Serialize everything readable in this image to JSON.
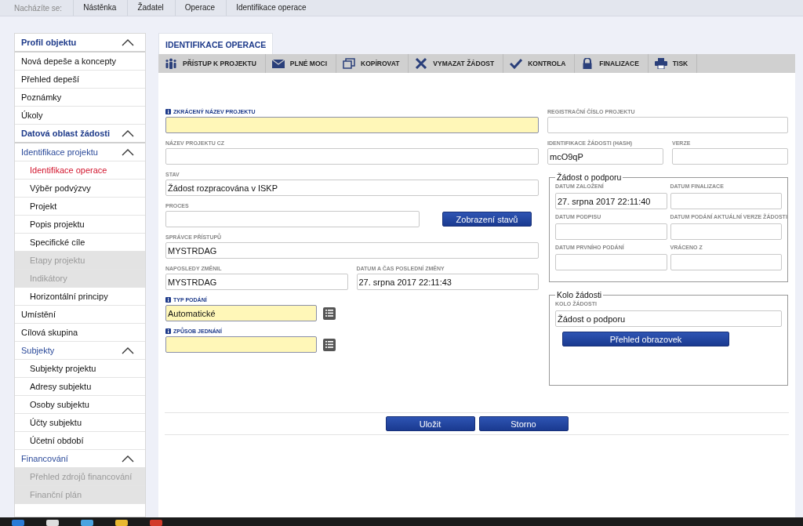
{
  "breadcrumb": {
    "prefix": "Nacházíte se:",
    "items": [
      "Nástěnka",
      "Žadatel",
      "Operace",
      "Identifikace operace"
    ]
  },
  "sidebar": [
    {
      "label": "Profil objektu",
      "kind": "section",
      "expanded": true,
      "children": [
        {
          "label": "Nová depeše a koncepty",
          "kind": "item",
          "selected": false,
          "disabled": false
        },
        {
          "label": "Přehled depeší",
          "kind": "item",
          "selected": false,
          "disabled": false
        },
        {
          "label": "Poznámky",
          "kind": "item",
          "selected": false,
          "disabled": false
        },
        {
          "label": "Úkoly",
          "kind": "item",
          "selected": false,
          "disabled": false
        }
      ]
    },
    {
      "label": "Datová oblast žádosti",
      "kind": "section",
      "expanded": true,
      "children": [
        {
          "label": "Identifikace projektu",
          "kind": "group",
          "expanded": true,
          "children": [
            {
              "label": "Identifikace operace",
              "kind": "item",
              "selected": true,
              "disabled": false
            },
            {
              "label": "Výběr podvýzvy",
              "kind": "item",
              "selected": false,
              "disabled": false
            },
            {
              "label": "Projekt",
              "kind": "item",
              "selected": false,
              "disabled": false
            },
            {
              "label": "Popis projektu",
              "kind": "item",
              "selected": false,
              "disabled": false
            },
            {
              "label": "Specifické cíle",
              "kind": "item",
              "selected": false,
              "disabled": false
            },
            {
              "label": "Etapy projektu",
              "kind": "item",
              "selected": false,
              "disabled": true
            },
            {
              "label": "Indikátory",
              "kind": "item",
              "selected": false,
              "disabled": true
            },
            {
              "label": "Horizontální principy",
              "kind": "item",
              "selected": false,
              "disabled": false
            }
          ]
        },
        {
          "label": "Umístění",
          "kind": "item",
          "selected": false,
          "disabled": false
        },
        {
          "label": "Cílová skupina",
          "kind": "item",
          "selected": false,
          "disabled": false
        },
        {
          "label": "Subjekty",
          "kind": "group",
          "expanded": true,
          "children": [
            {
              "label": "Subjekty projektu",
              "kind": "item",
              "selected": false,
              "disabled": false
            },
            {
              "label": "Adresy subjektu",
              "kind": "item",
              "selected": false,
              "disabled": false
            },
            {
              "label": "Osoby subjektu",
              "kind": "item",
              "selected": false,
              "disabled": false
            },
            {
              "label": "Účty subjektu",
              "kind": "item",
              "selected": false,
              "disabled": false
            },
            {
              "label": "Účetní období",
              "kind": "item",
              "selected": false,
              "disabled": false
            }
          ]
        },
        {
          "label": "Financování",
          "kind": "group",
          "expanded": true,
          "children": [
            {
              "label": "Přehled zdrojů financování",
              "kind": "item",
              "selected": false,
              "disabled": true
            },
            {
              "label": "Finanční plán",
              "kind": "item",
              "selected": false,
              "disabled": true
            }
          ]
        }
      ]
    }
  ],
  "tabs": [
    {
      "label": "IDENTIFIKACE OPERACE",
      "selected": true
    }
  ],
  "toolbar": [
    "PŘÍSTUP K PROJEKTU",
    "PLNÉ MOCI",
    "KOPÍROVAT",
    "VYMAZAT ŽÁDOST",
    "KONTROLA",
    "FINALIZACE",
    "TISK"
  ],
  "left_form": [
    {
      "fields": [
        {
          "kind": "field",
          "label": "ZKRÁCENÝ NÁZEV PROJEKTU",
          "required": true
        }
      ]
    },
    {
      "fields": [
        {
          "kind": "field",
          "label": "NÁZEV PROJEKTU CZ",
          "required": false
        }
      ]
    },
    {
      "fields": [
        {
          "kind": "field",
          "label": "STAV",
          "value": "Žádost rozpracována v ISKP",
          "required": false
        }
      ]
    },
    {
      "fields": [
        {
          "kind": "field",
          "label": "PROCES",
          "required": false
        },
        {
          "kind": "button",
          "label": "Zobrazení stavů"
        }
      ]
    },
    {
      "fields": [
        {
          "kind": "field",
          "label": "SPRÁVCE PŘÍSTUPŮ",
          "value": "MYSTRDAG",
          "required": false
        }
      ]
    },
    {
      "fields": [
        {
          "kind": "field",
          "label": "NAPOSLEDY ZMĚNIL",
          "value": "MYSTRDAG",
          "required": false
        },
        {
          "kind": "field",
          "label": "DATUM A ČAS POSLEDNÍ ZMĚNY",
          "value": "27. srpna 2017 22:11:43",
          "required": false
        }
      ]
    },
    {
      "fields": [
        {
          "kind": "select",
          "label": "TYP PODÁNÍ",
          "value": "Automatické",
          "required": true
        }
      ]
    },
    {
      "fields": [
        {
          "kind": "select",
          "label": "ZPŮSOB JEDNÁNÍ",
          "required": true
        }
      ]
    }
  ],
  "right_form": [
    {
      "fields": [
        {
          "kind": "field",
          "label": "REGISTRAČNÍ ČÍSLO PROJEKTU",
          "required": false
        }
      ]
    },
    {
      "fields": [
        {
          "kind": "field",
          "label": "IDENTIFIKACE ŽÁDOSTI (HASH)",
          "value": "mcO9qP",
          "required": false
        },
        {
          "kind": "field",
          "label": "VERZE",
          "required": false
        }
      ]
    }
  ],
  "groups": [
    {
      "legend": "Žádost o podporu",
      "rows": [
        {
          "fields": [
            {
              "kind": "field",
              "label": "DATUM ZALOŽENÍ",
              "value": "27. srpna 2017 22:11:40",
              "required": false
            },
            {
              "kind": "field",
              "label": "DATUM FINALIZACE",
              "required": false
            }
          ]
        },
        {
          "fields": [
            {
              "kind": "field",
              "label": "DATUM PODPISU",
              "required": false
            },
            {
              "kind": "field",
              "label": "DATUM PODÁNÍ AKTUÁLNÍ VERZE ŽÁDOSTI",
              "required": false
            }
          ]
        },
        {
          "fields": [
            {
              "kind": "field",
              "label": "DATUM PRVNÍHO PODÁNÍ",
              "required": false
            },
            {
              "kind": "field",
              "label": "VRÁCENO Z",
              "required": false
            }
          ]
        }
      ]
    },
    {
      "legend": "Kolo žádosti",
      "rows": [
        {
          "fields": [
            {
              "kind": "field",
              "label": "KOLO ŽÁDOSTI",
              "value": "Žádost o podporu",
              "required": false
            }
          ]
        },
        {
          "fields": [
            {
              "kind": "button",
              "label": "Přehled obrazovek"
            }
          ]
        }
      ]
    }
  ],
  "actions": [
    "Uložit",
    "Storno"
  ]
}
